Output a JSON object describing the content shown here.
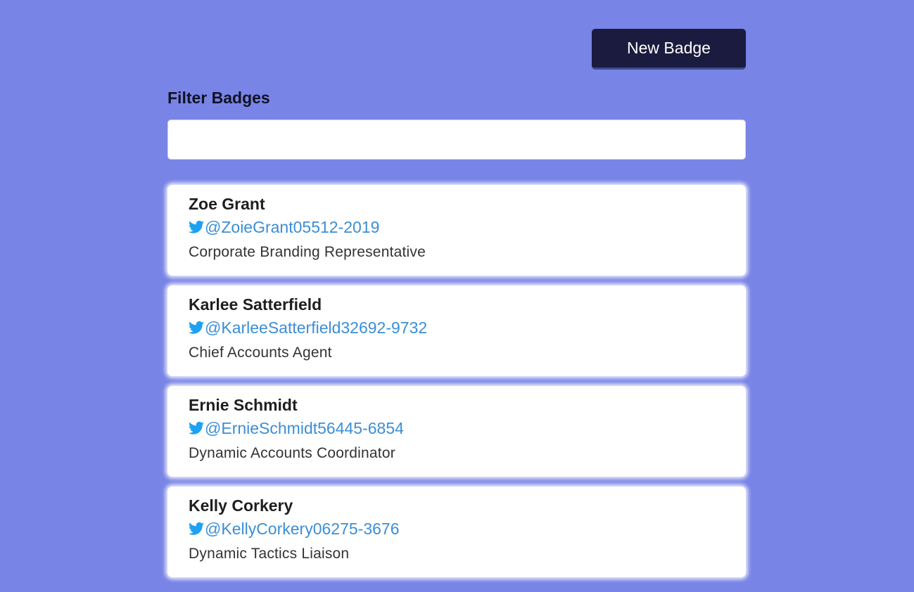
{
  "header": {
    "new_badge_label": "New Badge"
  },
  "filter": {
    "label": "Filter Badges",
    "value": "",
    "placeholder": ""
  },
  "colors": {
    "background": "#7884e6",
    "button": "#1b1b3f",
    "twitter": "#3b8ed6",
    "twitter_icon": "#1da1f2"
  },
  "badges": [
    {
      "name": "Zoe Grant",
      "twitter": "@ZoieGrant05512-2019",
      "job_title": "Corporate Branding Representative",
      "icon": "twitter-icon"
    },
    {
      "name": "Karlee Satterfield",
      "twitter": "@KarleeSatterfield32692-9732",
      "job_title": "Chief Accounts Agent",
      "icon": "twitter-icon"
    },
    {
      "name": "Ernie Schmidt",
      "twitter": "@ErnieSchmidt56445-6854",
      "job_title": "Dynamic Accounts Coordinator",
      "icon": "twitter-icon"
    },
    {
      "name": "Kelly Corkery",
      "twitter": "@KellyCorkery06275-3676",
      "job_title": "Dynamic Tactics Liaison",
      "icon": "twitter-icon"
    }
  ]
}
